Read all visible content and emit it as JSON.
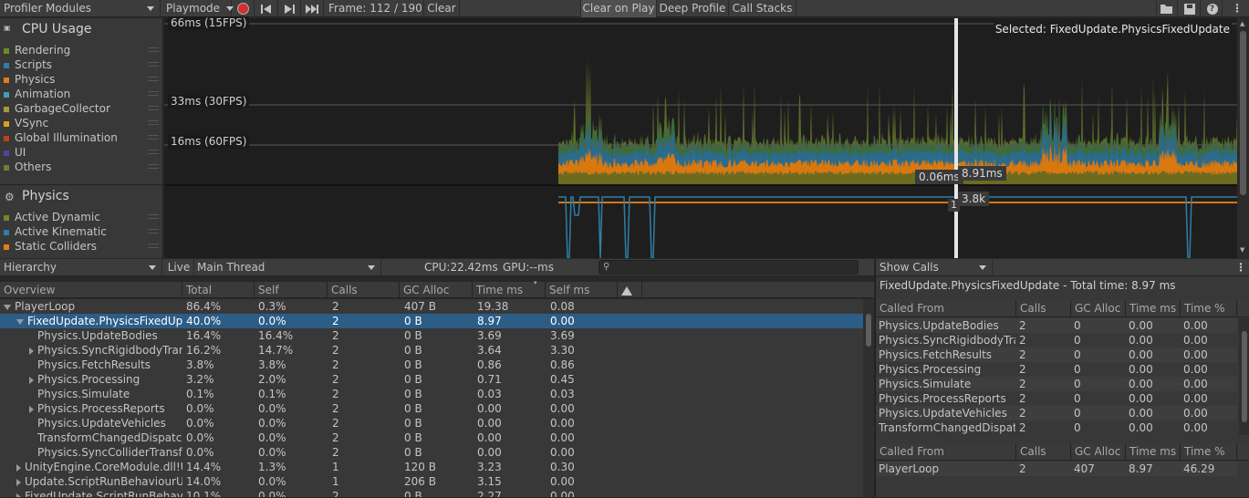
{
  "toolbar": {
    "modules_label": "Profiler Modules",
    "mode_label": "Playmode",
    "frame_label": "Frame: 112 / 190",
    "clear": "Clear",
    "clear_on_play": "Clear on Play",
    "deep_profile": "Deep Profile",
    "call_stacks": "Call Stacks"
  },
  "cpu_module": {
    "title": "CPU Usage",
    "series": [
      {
        "name": "Rendering",
        "color": "#6f8a2b"
      },
      {
        "name": "Scripts",
        "color": "#2f7ea8"
      },
      {
        "name": "Physics",
        "color": "#e07f15"
      },
      {
        "name": "Animation",
        "color": "#3aa0b0"
      },
      {
        "name": "GarbageCollector",
        "color": "#a09a3c"
      },
      {
        "name": "VSync",
        "color": "#d8a316"
      },
      {
        "name": "Global Illumination",
        "color": "#b04818"
      },
      {
        "name": "UI",
        "color": "#5a3fa8"
      },
      {
        "name": "Others",
        "color": "#6f7d3a"
      }
    ]
  },
  "physics_module": {
    "title": "Physics",
    "series": [
      {
        "name": "Active Dynamic",
        "color": "#6f8a2b"
      },
      {
        "name": "Active Kinematic",
        "color": "#2f7ea8"
      },
      {
        "name": "Static Colliders",
        "color": "#e07f15"
      }
    ]
  },
  "chart": {
    "line_66": "66ms (15FPS)",
    "line_33": "33ms (30FPS)",
    "line_16": "16ms (60FPS)",
    "selected_label": "Selected: FixedUpdate.PhysicsFixedUpdate",
    "tip_a": "0.06ms",
    "tip_b": "8.91ms",
    "tip_c": "1",
    "tip_d": "3.8k"
  },
  "hierarchy_bar": {
    "view": "Hierarchy",
    "live": "Live",
    "thread": "Main Thread",
    "cpu": "CPU:22.42ms",
    "gpu": "GPU:--ms",
    "search_placeholder": ""
  },
  "columns": [
    "Overview",
    "Total",
    "Self",
    "Calls",
    "GC Alloc",
    "Time ms",
    "Self ms"
  ],
  "rows": [
    {
      "name": "PlayerLoop",
      "total": "86.4%",
      "self": "0.3%",
      "calls": "2",
      "gc": "407 B",
      "time": "19.38",
      "selfms": "0.08"
    },
    {
      "name": "FixedUpdate.PhysicsFixedUpdate",
      "total": "40.0%",
      "self": "0.0%",
      "calls": "2",
      "gc": "0 B",
      "time": "8.97",
      "selfms": "0.00"
    },
    {
      "name": "Physics.UpdateBodies",
      "total": "16.4%",
      "self": "16.4%",
      "calls": "2",
      "gc": "0 B",
      "time": "3.69",
      "selfms": "3.69"
    },
    {
      "name": "Physics.SyncRigidbodyTransforms",
      "total": "16.2%",
      "self": "14.7%",
      "calls": "2",
      "gc": "0 B",
      "time": "3.64",
      "selfms": "3.30"
    },
    {
      "name": "Physics.FetchResults",
      "total": "3.8%",
      "self": "3.8%",
      "calls": "2",
      "gc": "0 B",
      "time": "0.86",
      "selfms": "0.86"
    },
    {
      "name": "Physics.Processing",
      "total": "3.2%",
      "self": "2.0%",
      "calls": "2",
      "gc": "0 B",
      "time": "0.71",
      "selfms": "0.45"
    },
    {
      "name": "Physics.Simulate",
      "total": "0.1%",
      "self": "0.1%",
      "calls": "2",
      "gc": "0 B",
      "time": "0.03",
      "selfms": "0.03"
    },
    {
      "name": "Physics.ProcessReports",
      "total": "0.0%",
      "self": "0.0%",
      "calls": "2",
      "gc": "0 B",
      "time": "0.00",
      "selfms": "0.00"
    },
    {
      "name": "Physics.UpdateVehicles",
      "total": "0.0%",
      "self": "0.0%",
      "calls": "2",
      "gc": "0 B",
      "time": "0.00",
      "selfms": "0.00"
    },
    {
      "name": "TransformChangedDispatch",
      "total": "0.0%",
      "self": "0.0%",
      "calls": "2",
      "gc": "0 B",
      "time": "0.00",
      "selfms": "0.00"
    },
    {
      "name": "Physics.SyncColliderTransforms",
      "total": "0.0%",
      "self": "0.0%",
      "calls": "2",
      "gc": "0 B",
      "time": "0.00",
      "selfms": "0.00"
    },
    {
      "name": "UnityEngine.CoreModule.dll!UnityEngine",
      "total": "14.4%",
      "self": "1.3%",
      "calls": "1",
      "gc": "120 B",
      "time": "3.23",
      "selfms": "0.30"
    },
    {
      "name": "Update.ScriptRunBehaviourUpdate",
      "total": "14.0%",
      "self": "0.0%",
      "calls": "1",
      "gc": "206 B",
      "time": "3.15",
      "selfms": "0.00"
    },
    {
      "name": "FixedUpdate.ScriptRunBehaviourFixedUpdate",
      "total": "10.1%",
      "self": "0.0%",
      "calls": "2",
      "gc": "0 B",
      "time": "2.27",
      "selfms": "0.00"
    }
  ],
  "right_panel": {
    "show_calls": "Show Calls",
    "summary": "FixedUpdate.PhysicsFixedUpdate - Total time: 8.97 ms",
    "columns_top": [
      "Called From",
      "Calls",
      "GC Alloc",
      "Time ms",
      "Time %"
    ],
    "top_rows": [
      {
        "name": "Physics.UpdateBodies",
        "calls": "2",
        "gc": "0",
        "time": "0.00",
        "pct": "0.00"
      },
      {
        "name": "Physics.SyncRigidbodyTransforms",
        "calls": "2",
        "gc": "0",
        "time": "0.00",
        "pct": "0.00"
      },
      {
        "name": "Physics.FetchResults",
        "calls": "2",
        "gc": "0",
        "time": "0.00",
        "pct": "0.00"
      },
      {
        "name": "Physics.Processing",
        "calls": "2",
        "gc": "0",
        "time": "0.00",
        "pct": "0.00"
      },
      {
        "name": "Physics.Simulate",
        "calls": "2",
        "gc": "0",
        "time": "0.00",
        "pct": "0.00"
      },
      {
        "name": "Physics.ProcessReports",
        "calls": "2",
        "gc": "0",
        "time": "0.00",
        "pct": "0.00"
      },
      {
        "name": "Physics.UpdateVehicles",
        "calls": "2",
        "gc": "0",
        "time": "0.00",
        "pct": "0.00"
      },
      {
        "name": "TransformChangedDispatch",
        "calls": "2",
        "gc": "0",
        "time": "0.00",
        "pct": "0.00"
      }
    ],
    "columns_bottom": [
      "Called From",
      "Calls",
      "GC Alloc",
      "Time ms",
      "Time %"
    ],
    "bottom_rows": [
      {
        "name": "PlayerLoop",
        "calls": "2",
        "gc": "407",
        "time": "8.97",
        "pct": "46.29"
      }
    ]
  }
}
